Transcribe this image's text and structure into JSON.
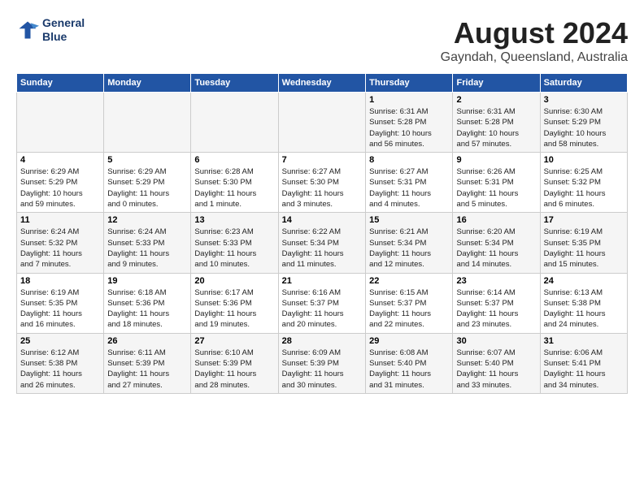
{
  "header": {
    "logo_line1": "General",
    "logo_line2": "Blue",
    "month_year": "August 2024",
    "location": "Gayndah, Queensland, Australia"
  },
  "weekdays": [
    "Sunday",
    "Monday",
    "Tuesday",
    "Wednesday",
    "Thursday",
    "Friday",
    "Saturday"
  ],
  "weeks": [
    [
      {
        "day": "",
        "info": ""
      },
      {
        "day": "",
        "info": ""
      },
      {
        "day": "",
        "info": ""
      },
      {
        "day": "",
        "info": ""
      },
      {
        "day": "1",
        "info": "Sunrise: 6:31 AM\nSunset: 5:28 PM\nDaylight: 10 hours\nand 56 minutes."
      },
      {
        "day": "2",
        "info": "Sunrise: 6:31 AM\nSunset: 5:28 PM\nDaylight: 10 hours\nand 57 minutes."
      },
      {
        "day": "3",
        "info": "Sunrise: 6:30 AM\nSunset: 5:29 PM\nDaylight: 10 hours\nand 58 minutes."
      }
    ],
    [
      {
        "day": "4",
        "info": "Sunrise: 6:29 AM\nSunset: 5:29 PM\nDaylight: 10 hours\nand 59 minutes."
      },
      {
        "day": "5",
        "info": "Sunrise: 6:29 AM\nSunset: 5:29 PM\nDaylight: 11 hours\nand 0 minutes."
      },
      {
        "day": "6",
        "info": "Sunrise: 6:28 AM\nSunset: 5:30 PM\nDaylight: 11 hours\nand 1 minute."
      },
      {
        "day": "7",
        "info": "Sunrise: 6:27 AM\nSunset: 5:30 PM\nDaylight: 11 hours\nand 3 minutes."
      },
      {
        "day": "8",
        "info": "Sunrise: 6:27 AM\nSunset: 5:31 PM\nDaylight: 11 hours\nand 4 minutes."
      },
      {
        "day": "9",
        "info": "Sunrise: 6:26 AM\nSunset: 5:31 PM\nDaylight: 11 hours\nand 5 minutes."
      },
      {
        "day": "10",
        "info": "Sunrise: 6:25 AM\nSunset: 5:32 PM\nDaylight: 11 hours\nand 6 minutes."
      }
    ],
    [
      {
        "day": "11",
        "info": "Sunrise: 6:24 AM\nSunset: 5:32 PM\nDaylight: 11 hours\nand 7 minutes."
      },
      {
        "day": "12",
        "info": "Sunrise: 6:24 AM\nSunset: 5:33 PM\nDaylight: 11 hours\nand 9 minutes."
      },
      {
        "day": "13",
        "info": "Sunrise: 6:23 AM\nSunset: 5:33 PM\nDaylight: 11 hours\nand 10 minutes."
      },
      {
        "day": "14",
        "info": "Sunrise: 6:22 AM\nSunset: 5:34 PM\nDaylight: 11 hours\nand 11 minutes."
      },
      {
        "day": "15",
        "info": "Sunrise: 6:21 AM\nSunset: 5:34 PM\nDaylight: 11 hours\nand 12 minutes."
      },
      {
        "day": "16",
        "info": "Sunrise: 6:20 AM\nSunset: 5:34 PM\nDaylight: 11 hours\nand 14 minutes."
      },
      {
        "day": "17",
        "info": "Sunrise: 6:19 AM\nSunset: 5:35 PM\nDaylight: 11 hours\nand 15 minutes."
      }
    ],
    [
      {
        "day": "18",
        "info": "Sunrise: 6:19 AM\nSunset: 5:35 PM\nDaylight: 11 hours\nand 16 minutes."
      },
      {
        "day": "19",
        "info": "Sunrise: 6:18 AM\nSunset: 5:36 PM\nDaylight: 11 hours\nand 18 minutes."
      },
      {
        "day": "20",
        "info": "Sunrise: 6:17 AM\nSunset: 5:36 PM\nDaylight: 11 hours\nand 19 minutes."
      },
      {
        "day": "21",
        "info": "Sunrise: 6:16 AM\nSunset: 5:37 PM\nDaylight: 11 hours\nand 20 minutes."
      },
      {
        "day": "22",
        "info": "Sunrise: 6:15 AM\nSunset: 5:37 PM\nDaylight: 11 hours\nand 22 minutes."
      },
      {
        "day": "23",
        "info": "Sunrise: 6:14 AM\nSunset: 5:37 PM\nDaylight: 11 hours\nand 23 minutes."
      },
      {
        "day": "24",
        "info": "Sunrise: 6:13 AM\nSunset: 5:38 PM\nDaylight: 11 hours\nand 24 minutes."
      }
    ],
    [
      {
        "day": "25",
        "info": "Sunrise: 6:12 AM\nSunset: 5:38 PM\nDaylight: 11 hours\nand 26 minutes."
      },
      {
        "day": "26",
        "info": "Sunrise: 6:11 AM\nSunset: 5:39 PM\nDaylight: 11 hours\nand 27 minutes."
      },
      {
        "day": "27",
        "info": "Sunrise: 6:10 AM\nSunset: 5:39 PM\nDaylight: 11 hours\nand 28 minutes."
      },
      {
        "day": "28",
        "info": "Sunrise: 6:09 AM\nSunset: 5:39 PM\nDaylight: 11 hours\nand 30 minutes."
      },
      {
        "day": "29",
        "info": "Sunrise: 6:08 AM\nSunset: 5:40 PM\nDaylight: 11 hours\nand 31 minutes."
      },
      {
        "day": "30",
        "info": "Sunrise: 6:07 AM\nSunset: 5:40 PM\nDaylight: 11 hours\nand 33 minutes."
      },
      {
        "day": "31",
        "info": "Sunrise: 6:06 AM\nSunset: 5:41 PM\nDaylight: 11 hours\nand 34 minutes."
      }
    ]
  ]
}
